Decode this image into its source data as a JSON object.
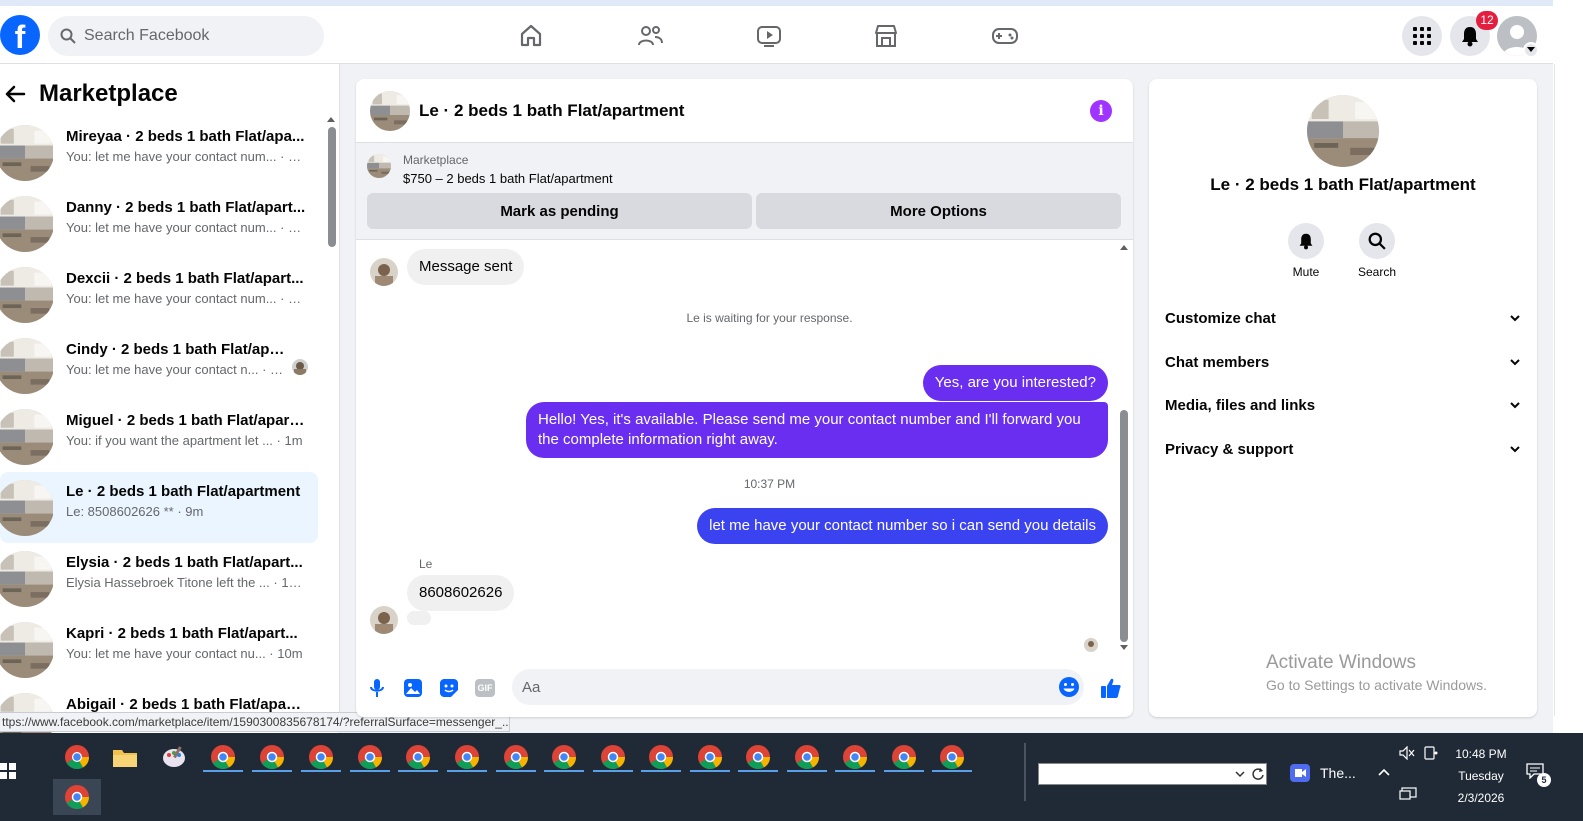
{
  "topnav": {
    "logo": "f",
    "search_placeholder": "Search Facebook",
    "notification_count": "12",
    "nav_icons": [
      "home-icon",
      "friends-icon",
      "video-icon",
      "marketplace-icon",
      "gaming-icon"
    ],
    "menu_icon": "grid-menu-icon",
    "bell_icon": "bell-icon"
  },
  "sidebar": {
    "title": "Marketplace",
    "conversations": [
      {
        "name": "Mireyaa · 2 beds 1 bath Flat/apa...",
        "preview": "You: let me have your contact num... · 1m"
      },
      {
        "name": "Danny · 2 beds 1 bath Flat/apart...",
        "preview": "You: let me have your contact num... · 1m"
      },
      {
        "name": "Dexcii · 2 beds 1 bath Flat/apart...",
        "preview": "You: let me have your contact num... · 1m"
      },
      {
        "name": "Cindy · 2 beds 1 bath Flat/apa...",
        "preview": "You: let me have your contact n... · 1m"
      },
      {
        "name": "Miguel · 2 beds 1 bath Flat/apart...",
        "preview": "You: if you want the apartment let ... · 1m"
      },
      {
        "name": "Le · 2 beds 1 bath Flat/apartment",
        "preview": "Le: 8508602626 ** · 9m"
      },
      {
        "name": "Elysia · 2 beds 1 bath Flat/apart...",
        "preview": "Elysia Hassebroek Titone left the ... · 10m"
      },
      {
        "name": "Kapri · 2 beds 1 bath Flat/apart...",
        "preview": "You: let me have your contact nu... · 10m"
      },
      {
        "name": "Abigail · 2 beds 1 bath Flat/apart...",
        "preview": ""
      }
    ]
  },
  "status_url": "ttps://www.facebook.com/marketplace/item/1590300835678174/?referralSurface=messenger_...",
  "chat": {
    "title": "Le · 2 beds 1 bath Flat/apartment",
    "info_glyph": "i",
    "listing": {
      "source": "Marketplace",
      "price_title": "$750 – 2 beds 1 bath Flat/apartment",
      "pending_label": "Mark as pending",
      "more_label": "More Options"
    },
    "messages": {
      "message_sent": "Message sent",
      "waiting_note": "Le is waiting for your response.",
      "out1": "Yes, are you interested?",
      "out2": "Hello! Yes, it's available. Please send me your contact number and I'll forward you the complete information right away.",
      "timestamp": "10:37 PM",
      "out3": "let me have your contact number so i can send you details",
      "sender": "Le",
      "in1": "8608602626"
    },
    "composer_placeholder": "Aa",
    "composer_icons": [
      "microphone-icon",
      "photo-icon",
      "sticker-icon",
      "gif-icon",
      "emoji-icon",
      "like-icon"
    ],
    "gif_label": "GIF"
  },
  "info": {
    "title": "Le · 2 beds 1 bath Flat/apartment",
    "mute_label": "Mute",
    "search_label": "Search",
    "sections": [
      "Customize chat",
      "Chat members",
      "Media, files and links",
      "Privacy & support"
    ],
    "watermark_title": "Activate Windows",
    "watermark_sub": "Go to Settings to activate Windows."
  },
  "taskbar": {
    "zoom_label": "The...",
    "time": "10:48 PM",
    "day": "Tuesday",
    "date": "2/3/2026",
    "notif_count": "5"
  },
  "colors": {
    "facebook_blue": "#0866ff",
    "outgoing_bubble": "#6a2ef0",
    "outgoing_bubble_late": "#3b43f0",
    "info_purple": "#a033ff",
    "badge_red": "#e41e3f",
    "active_row": "#ebf5ff",
    "taskbar": "#1f2a36"
  }
}
